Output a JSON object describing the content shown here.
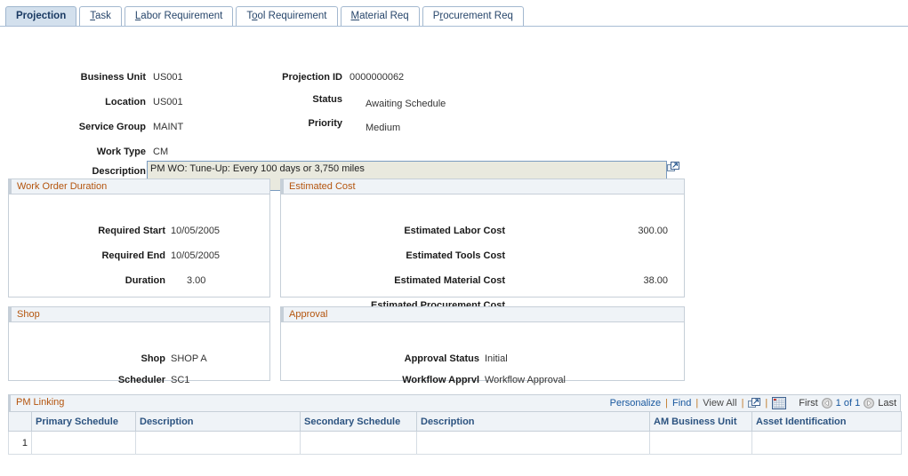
{
  "tabs": [
    {
      "label": "Projection",
      "accesskey": "",
      "selected": true
    },
    {
      "label": "Task",
      "accesskey": "T",
      "selected": false
    },
    {
      "label": "Labor Requirement",
      "accesskey": "L",
      "selected": false
    },
    {
      "label": "Tool Requirement",
      "accesskey": "o",
      "selected": false
    },
    {
      "label": "Material Req",
      "accesskey": "M",
      "selected": false
    },
    {
      "label": "Procurement Req",
      "accesskey": "r",
      "selected": false
    }
  ],
  "header": {
    "business_unit_label": "Business Unit",
    "business_unit_value": "US001",
    "location_label": "Location",
    "location_value": "US001",
    "service_group_label": "Service Group",
    "service_group_value": "MAINT",
    "work_type_label": "Work Type",
    "work_type_value": "CM",
    "description_label": "Description",
    "description_value": "PM WO: Tune-Up: Every 100 days or 3,750 miles",
    "projection_id_label": "Projection ID",
    "projection_id_value": "0000000062",
    "status_label": "Status",
    "status_value": "Awaiting Schedule",
    "priority_label": "Priority",
    "priority_value": "Medium"
  },
  "work_order_duration": {
    "title": "Work Order Duration",
    "rows": [
      {
        "label": "Required Start",
        "value": "10/05/2005"
      },
      {
        "label": "Required End",
        "value": "10/05/2005"
      },
      {
        "label": "Duration",
        "value": "3.00"
      }
    ]
  },
  "estimated_cost": {
    "title": "Estimated Cost",
    "rows": [
      {
        "label": "Estimated Labor Cost",
        "value": "300.00"
      },
      {
        "label": "Estimated Tools Cost",
        "value": ""
      },
      {
        "label": "Estimated Material Cost",
        "value": "38.00"
      },
      {
        "label": "Estimated Procurement Cost",
        "value": ""
      }
    ]
  },
  "shop": {
    "title": "Shop",
    "rows": [
      {
        "label": "Shop",
        "value": "SHOP A"
      },
      {
        "label": "Scheduler",
        "value": "SC1"
      }
    ]
  },
  "approval": {
    "title": "Approval",
    "rows": [
      {
        "label": "Approval Status",
        "value": "Initial"
      },
      {
        "label": "Workflow Apprvl",
        "value": "Workflow Approval"
      }
    ]
  },
  "pm_linking": {
    "title": "PM Linking",
    "toolbar": {
      "personalize": "Personalize",
      "find": "Find",
      "view_all": "View All",
      "sep": "|",
      "new_window_icon": "new-window-icon",
      "download_grid_icon": "download-to-excel-icon"
    },
    "pager": {
      "first": "First",
      "prev_icon": "previous-arrow-icon",
      "position": "1 of 1",
      "next_icon": "next-arrow-icon",
      "last": "Last"
    },
    "columns": [
      "Primary Schedule",
      "Description",
      "Secondary Schedule",
      "Description",
      "AM Business Unit",
      "Asset Identification"
    ],
    "rows": [
      {
        "num": "1",
        "cells": [
          "",
          "",
          "",
          "",
          "",
          ""
        ]
      }
    ]
  },
  "colors": {
    "group_title": "#B4540D",
    "column_header_text": "#2C5380",
    "link": "#17579E",
    "separator": "#C07A28",
    "panel_bg": "#EFF3F7",
    "tab_selected_bg": "#D3E0ED",
    "textarea_bg": "#E9E9DE"
  }
}
